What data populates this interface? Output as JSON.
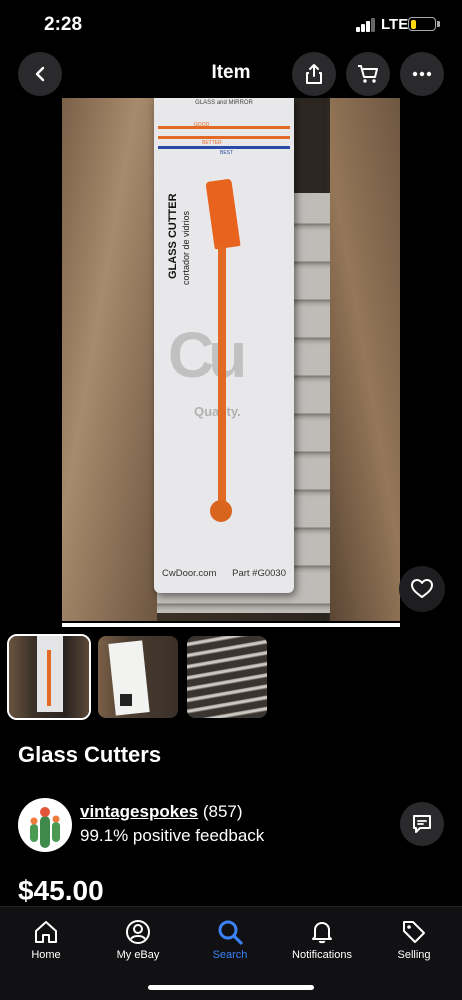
{
  "status": {
    "time": "2:28",
    "network": "LTE",
    "battery_percent": 20
  },
  "nav": {
    "title": "Item",
    "icons": [
      "back-icon",
      "share-icon",
      "cart-icon",
      "more-icon"
    ]
  },
  "hero": {
    "card_brand": "GLASS CUTTER",
    "card_subtitle": "cortador de vidrios",
    "card_header": "GLASS and MIRROR",
    "card_tiers": [
      "GOOD",
      "BETTER",
      "BEST"
    ],
    "card_site": "CwDoor.com",
    "card_part": "Part #G0030",
    "logo_text": "Cu",
    "quality_text": "Quality."
  },
  "item": {
    "title": "Glass Cutters",
    "price": "$45.00"
  },
  "seller": {
    "username": "vintagespokes",
    "rating_count": "(857)",
    "feedback": "99.1% positive feedback"
  },
  "tabs": [
    {
      "label": "Home",
      "icon": "home-icon"
    },
    {
      "label": "My eBay",
      "icon": "user-icon"
    },
    {
      "label": "Search",
      "icon": "search-icon"
    },
    {
      "label": "Notifications",
      "icon": "bell-icon"
    },
    {
      "label": "Selling",
      "icon": "tag-icon"
    }
  ],
  "colors": {
    "accent": "#3b82f6",
    "cutter_orange": "#e36a24",
    "battery": "#ffd60a"
  }
}
